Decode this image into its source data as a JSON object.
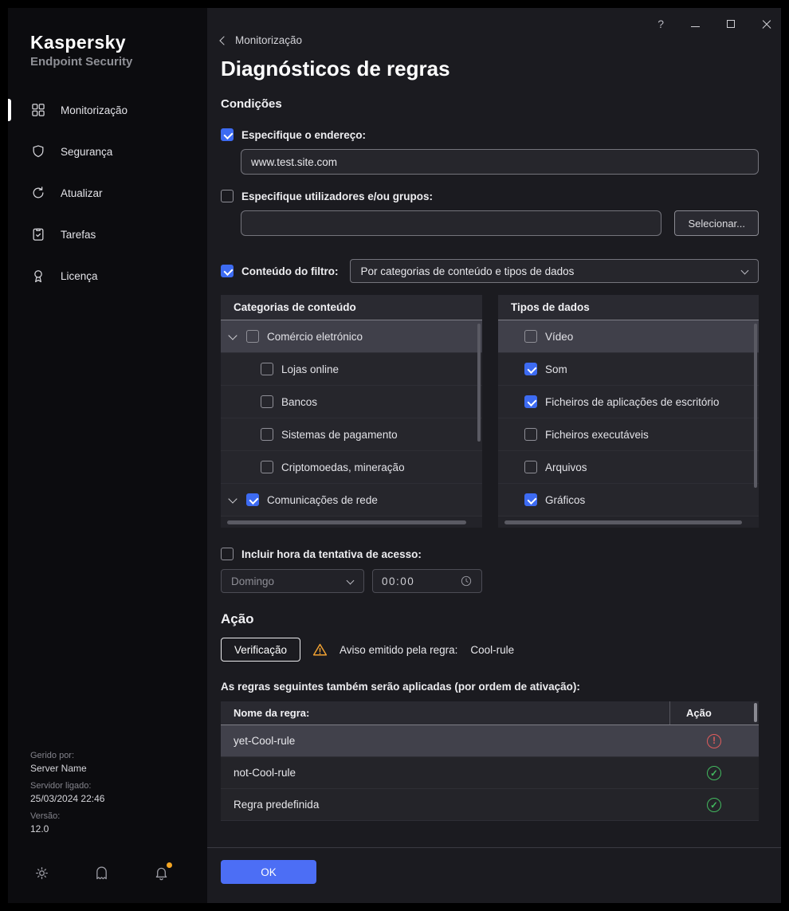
{
  "window_controls": {
    "help": "?"
  },
  "sidebar": {
    "brand_line1": "Kaspersky",
    "brand_line2": "Endpoint Security",
    "items": [
      {
        "label": "Monitorização",
        "active": true
      },
      {
        "label": "Segurança",
        "active": false
      },
      {
        "label": "Atualizar",
        "active": false
      },
      {
        "label": "Tarefas",
        "active": false
      },
      {
        "label": "Licença",
        "active": false
      }
    ],
    "footer": {
      "managed_by_label": "Gerido por:",
      "managed_by_value": "Server Name",
      "server_label": "Servidor ligado:",
      "server_value": "25/03/2024 22:46",
      "version_label": "Versão:",
      "version_value": "12.0"
    }
  },
  "header": {
    "back_label": "Monitorização",
    "title": "Diagnósticos de regras"
  },
  "conditions": {
    "section_title": "Condições",
    "address": {
      "checked": true,
      "label": "Especifique o endereço:",
      "value": "www.test.site.com"
    },
    "users": {
      "checked": false,
      "label": "Especifique utilizadores e/ou grupos:",
      "value": "",
      "select_button": "Selecionar..."
    },
    "filter": {
      "checked": true,
      "label": "Conteúdo do filtro:",
      "selected_option": "Por categorias de conteúdo e tipos de dados"
    },
    "categories": {
      "header": "Categorias de conteúdo",
      "items": [
        {
          "label": "Comércio eletrónico",
          "expandable": true,
          "checked": false,
          "highlighted": true,
          "indent": 0
        },
        {
          "label": "Lojas online",
          "expandable": false,
          "checked": false,
          "highlighted": false,
          "indent": 1
        },
        {
          "label": "Bancos",
          "expandable": false,
          "checked": false,
          "highlighted": false,
          "indent": 1
        },
        {
          "label": "Sistemas de pagamento",
          "expandable": false,
          "checked": false,
          "highlighted": false,
          "indent": 1
        },
        {
          "label": "Criptomoedas, mineração",
          "expandable": false,
          "checked": false,
          "highlighted": false,
          "indent": 1
        },
        {
          "label": "Comunicações de rede",
          "expandable": true,
          "checked": true,
          "highlighted": false,
          "indent": 0
        }
      ]
    },
    "data_types": {
      "header": "Tipos de dados",
      "items": [
        {
          "label": "Vídeo",
          "checked": false,
          "highlighted": true
        },
        {
          "label": "Som",
          "checked": true,
          "highlighted": false
        },
        {
          "label": "Ficheiros de aplicações de escritório",
          "checked": true,
          "highlighted": false
        },
        {
          "label": "Ficheiros executáveis",
          "checked": false,
          "highlighted": false
        },
        {
          "label": "Arquivos",
          "checked": false,
          "highlighted": false
        },
        {
          "label": "Gráficos",
          "checked": true,
          "highlighted": false
        }
      ]
    },
    "access_time": {
      "checked": false,
      "label": "Incluir hora da tentativa de acesso:",
      "day": "Domingo",
      "time": "00:00"
    }
  },
  "action": {
    "section_title": "Ação",
    "verify_button": "Verificação",
    "warning_label": "Aviso emitido pela regra:",
    "warning_rule": "Cool-rule",
    "rules_intro": "As regras seguintes também serão aplicadas (por ordem de ativação):",
    "table": {
      "name_header": "Nome da regra:",
      "action_header": "Ação",
      "rows": [
        {
          "name": "yet-Cool-rule",
          "status": "error",
          "highlighted": true
        },
        {
          "name": "not-Cool-rule",
          "status": "ok",
          "highlighted": false
        },
        {
          "name": "Regra predefinida",
          "status": "ok",
          "highlighted": false
        }
      ]
    }
  },
  "footer_bar": {
    "ok_button": "OK"
  }
}
